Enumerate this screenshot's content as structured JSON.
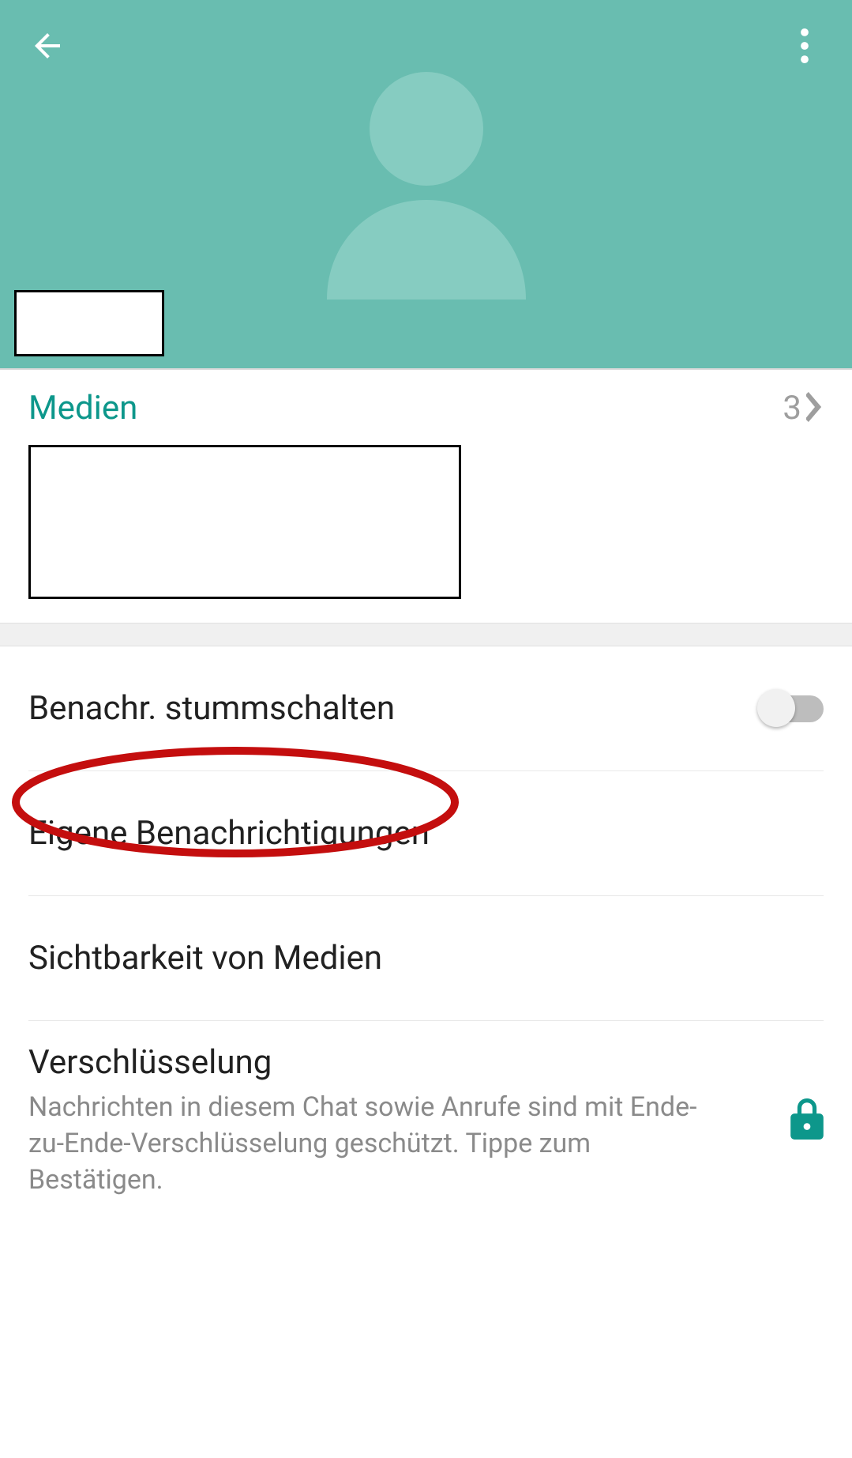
{
  "header": {
    "contact_name": ""
  },
  "media": {
    "label": "Medien",
    "count": "3"
  },
  "settings": {
    "mute_label": "Benachr. stummschalten",
    "custom_notifications_label": "Eigene Benachrichtigungen",
    "media_visibility_label": "Sichtbarkeit von Medien",
    "encryption_label": "Verschlüsselung",
    "encryption_sub": "Nachrichten in diesem Chat sowie Anrufe sind mit Ende-zu-Ende-Verschlüsselung geschützt. Tippe zum Bestätigen."
  }
}
